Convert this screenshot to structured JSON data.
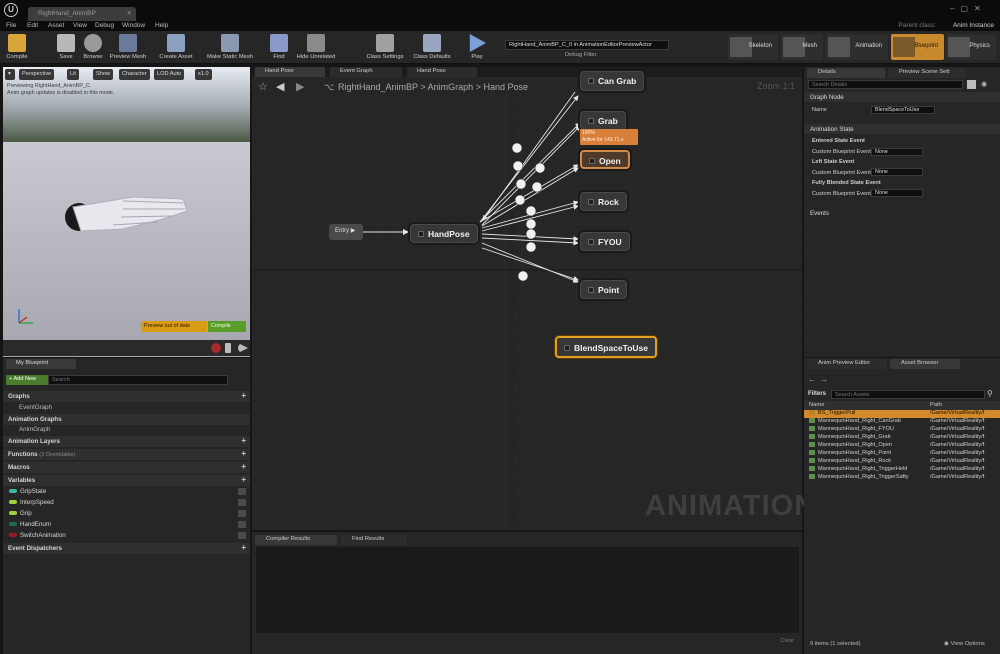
{
  "window": {
    "tab_title": "RightHand_AnimBP",
    "parent_class_label": "Parent class:",
    "parent_class_value": "Anim Instance"
  },
  "menu": [
    "File",
    "Edit",
    "Asset",
    "View",
    "Debug",
    "Window",
    "Help"
  ],
  "toolbar": {
    "buttons": [
      {
        "label": "Compile",
        "icon": "compile-icon"
      },
      {
        "label": "Save",
        "icon": "save-icon"
      },
      {
        "label": "Browse",
        "icon": "browse-icon"
      },
      {
        "label": "Preview Mesh",
        "icon": "preview-mesh-icon"
      },
      {
        "label": "Create Asset",
        "icon": "create-asset-icon"
      },
      {
        "label": "Make Static Mesh",
        "icon": "static-mesh-icon"
      },
      {
        "label": "Find",
        "icon": "find-icon"
      },
      {
        "label": "Hide Unrelated",
        "icon": "hide-unrelated-icon"
      },
      {
        "label": "Class Settings",
        "icon": "class-settings-icon"
      },
      {
        "label": "Class Defaults",
        "icon": "class-defaults-icon"
      },
      {
        "label": "Play",
        "icon": "play-icon"
      }
    ],
    "debug_select": "RightHand_AnimBP_C_0 in AnimationEditorPreviewActor",
    "debug_filter": "Debug Filter",
    "modes": [
      "Skeleton",
      "Mesh",
      "Animation",
      "Blueprint",
      "Physics"
    ]
  },
  "viewport": {
    "chips": [
      "Perspective",
      "Lit",
      "Show",
      "Character",
      "LOD Auto",
      "x1.0"
    ],
    "preview_text": [
      "Previewing RightHand_AnimBP_C.",
      "Anim graph updates is disabled in this mode."
    ],
    "badge_out": "Preview out of date",
    "badge_ok": "Compile"
  },
  "my_blueprint": {
    "tab": "My Blueprint",
    "add_new": "+ Add New",
    "search_placeholder": "Search",
    "sections": {
      "graphs": "Graphs",
      "event_graph": "EventGraph",
      "anim_graphs": "Animation Graphs",
      "anim_graph": "AnimGraph",
      "anim_layers": "Animation Layers",
      "functions": "Functions",
      "functions_note": "(3 Overridable)",
      "macros": "Macros",
      "variables": "Variables",
      "dispatchers": "Event Dispatchers"
    },
    "variables": [
      {
        "name": "GripState",
        "color": "#3fb4a8"
      },
      {
        "name": "InterpSpeed",
        "color": "#9ad43a"
      },
      {
        "name": "Grip",
        "color": "#9ad43a"
      },
      {
        "name": "HandEnum",
        "color": "#1d6b52"
      },
      {
        "name": "SwitchAnimation",
        "color": "#9a1b1b"
      }
    ]
  },
  "graph": {
    "tabs": [
      "Hand Pose",
      "Event Graph",
      "Hand Pose"
    ],
    "breadcrumb": [
      "RightHand_AnimBP",
      "AnimGraph",
      "Hand Pose"
    ],
    "zoom": "Zoom 1:1",
    "entry": "Entry",
    "center": "HandPose",
    "states": [
      "Can Grab",
      "Grab",
      "Open",
      "Rock",
      "FYOU",
      "Point"
    ],
    "open_note": [
      "100%",
      "Active for 143.71 s"
    ],
    "blend": "BlendSpaceToUse",
    "watermark": "ANIMATION"
  },
  "compiler": {
    "tabs": [
      "Compiler Results",
      "Find Results"
    ],
    "clear": "Clear"
  },
  "details": {
    "tabs": [
      "Details",
      "Preview Scene Sett"
    ],
    "search_placeholder": "Search Details",
    "graph_node": "Graph Node",
    "name_label": "Name",
    "name_value": "BlendSpaceToUse",
    "anim_state": "Animation State",
    "entered": "Entered State Event",
    "left": "Left State Event",
    "fully": "Fully Blended State Event",
    "custom_label": "Custom Blueprint Event",
    "none": "None",
    "events": "Events"
  },
  "assets": {
    "tabs": [
      "Anim Preview Editor",
      "Asset Browser"
    ],
    "filters": "Filters",
    "search_placeholder": "Search Assets",
    "col_name": "Name",
    "col_path": "Path",
    "rows": [
      {
        "name": "BS_TriggerPull",
        "path": "/Game/VirtualReality/f",
        "selected": true
      },
      {
        "name": "MannequinHand_Right_CanGrab",
        "path": "/Game/VirtualReality/f",
        "selected": false
      },
      {
        "name": "MannequinHand_Right_FYOU",
        "path": "/Game/VirtualReality/f",
        "selected": false
      },
      {
        "name": "MannequinHand_Right_Grab",
        "path": "/Game/VirtualReality/f",
        "selected": false
      },
      {
        "name": "MannequinHand_Right_Open",
        "path": "/Game/VirtualReality/f",
        "selected": false
      },
      {
        "name": "MannequinHand_Right_Point",
        "path": "/Game/VirtualReality/f",
        "selected": false
      },
      {
        "name": "MannequinHand_Right_Rock",
        "path": "/Game/VirtualReality/f",
        "selected": false
      },
      {
        "name": "MannequinHand_Right_TriggerHeld",
        "path": "/Game/VirtualReality/f",
        "selected": false
      },
      {
        "name": "MannequinHand_Right_TriggerSafty",
        "path": "/Game/VirtualReality/f",
        "selected": false
      }
    ],
    "footer": "9 items (1 selected)",
    "view_options": "View Options"
  }
}
